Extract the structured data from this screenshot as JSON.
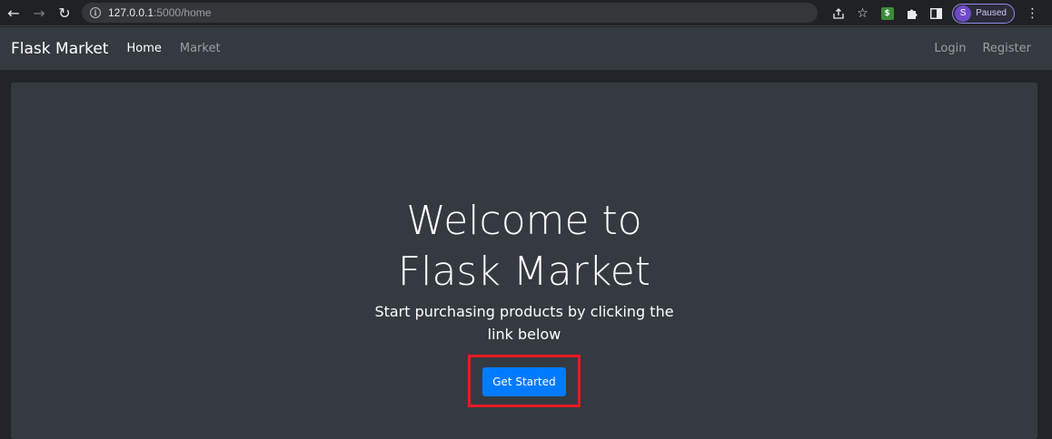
{
  "browser": {
    "url_host": "127.0.0.1",
    "url_path": ":5000/home",
    "profile_initial": "S",
    "profile_status": "Paused",
    "icons": [
      "back-arrow-icon",
      "forward-arrow-icon",
      "reload-icon",
      "info-icon",
      "share-icon",
      "star-icon",
      "extension-icon",
      "puzzle-icon",
      "sidepanel-icon",
      "kebab-menu-icon"
    ]
  },
  "navbar": {
    "brand": "Flask Market",
    "links": [
      "Home",
      "Market"
    ],
    "right_links": [
      "Login",
      "Register"
    ]
  },
  "hero": {
    "title": "Welcome to Flask Market",
    "subtitle": "Start purchasing products by clicking the link below",
    "cta_label": "Get Started"
  },
  "colors": {
    "page_bg": "#212529",
    "navbar_bg": "#343a40",
    "primary": "#007bff",
    "highlight": "#e51b23"
  }
}
